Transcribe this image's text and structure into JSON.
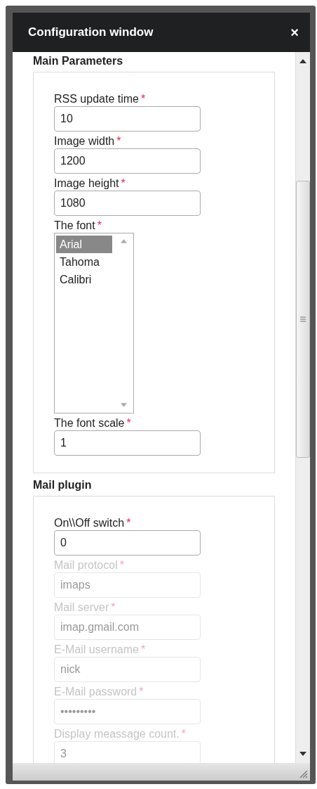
{
  "window": {
    "title": "Configuration window",
    "close": "×"
  },
  "sections": [
    {
      "title": "Main Parameters",
      "fields": [
        {
          "kind": "text",
          "label": "RSS update time",
          "required": "*",
          "value": "10",
          "disabled": false
        },
        {
          "kind": "text",
          "label": "Image width",
          "required": "*",
          "value": "1200",
          "disabled": false
        },
        {
          "kind": "text",
          "label": "Image height",
          "required": "*",
          "value": "1080",
          "disabled": false
        },
        {
          "kind": "list",
          "label": "The font",
          "required": "*",
          "disabled": false,
          "options": [
            {
              "label": "Arial",
              "selected": true
            },
            {
              "label": "Tahoma",
              "selected": false
            },
            {
              "label": "Calibri",
              "selected": false
            }
          ]
        },
        {
          "kind": "text",
          "label": "The font scale",
          "required": "*",
          "value": "1",
          "disabled": false
        }
      ]
    },
    {
      "title": "Mail plugin",
      "fields": [
        {
          "kind": "text",
          "label": "On\\\\Off switch",
          "required": "*",
          "value": "0",
          "disabled": false
        },
        {
          "kind": "text",
          "label": "Mail protocol",
          "required": "*",
          "value": "imaps",
          "disabled": true
        },
        {
          "kind": "text",
          "label": "Mail server",
          "required": "*",
          "value": "imap.gmail.com",
          "disabled": true
        },
        {
          "kind": "text",
          "label": "E-Mail username",
          "required": "*",
          "value": "nick",
          "disabled": true
        },
        {
          "kind": "text",
          "label": "E-Mail password",
          "required": "*",
          "value": "•••••••••",
          "disabled": true
        },
        {
          "kind": "text",
          "label": "Display meassage count.",
          "required": "*",
          "value": "3",
          "disabled": true
        }
      ]
    }
  ]
}
